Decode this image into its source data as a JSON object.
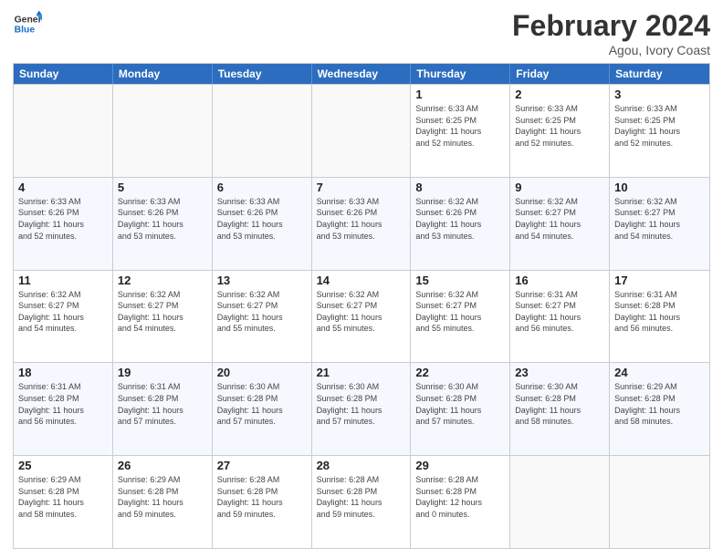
{
  "header": {
    "logo_general": "General",
    "logo_blue": "Blue",
    "month_year": "February 2024",
    "location": "Agou, Ivory Coast"
  },
  "days_of_week": [
    "Sunday",
    "Monday",
    "Tuesday",
    "Wednesday",
    "Thursday",
    "Friday",
    "Saturday"
  ],
  "rows": [
    [
      {
        "day": "",
        "info": ""
      },
      {
        "day": "",
        "info": ""
      },
      {
        "day": "",
        "info": ""
      },
      {
        "day": "",
        "info": ""
      },
      {
        "day": "1",
        "info": "Sunrise: 6:33 AM\nSunset: 6:25 PM\nDaylight: 11 hours\nand 52 minutes."
      },
      {
        "day": "2",
        "info": "Sunrise: 6:33 AM\nSunset: 6:25 PM\nDaylight: 11 hours\nand 52 minutes."
      },
      {
        "day": "3",
        "info": "Sunrise: 6:33 AM\nSunset: 6:25 PM\nDaylight: 11 hours\nand 52 minutes."
      }
    ],
    [
      {
        "day": "4",
        "info": "Sunrise: 6:33 AM\nSunset: 6:26 PM\nDaylight: 11 hours\nand 52 minutes."
      },
      {
        "day": "5",
        "info": "Sunrise: 6:33 AM\nSunset: 6:26 PM\nDaylight: 11 hours\nand 53 minutes."
      },
      {
        "day": "6",
        "info": "Sunrise: 6:33 AM\nSunset: 6:26 PM\nDaylight: 11 hours\nand 53 minutes."
      },
      {
        "day": "7",
        "info": "Sunrise: 6:33 AM\nSunset: 6:26 PM\nDaylight: 11 hours\nand 53 minutes."
      },
      {
        "day": "8",
        "info": "Sunrise: 6:32 AM\nSunset: 6:26 PM\nDaylight: 11 hours\nand 53 minutes."
      },
      {
        "day": "9",
        "info": "Sunrise: 6:32 AM\nSunset: 6:27 PM\nDaylight: 11 hours\nand 54 minutes."
      },
      {
        "day": "10",
        "info": "Sunrise: 6:32 AM\nSunset: 6:27 PM\nDaylight: 11 hours\nand 54 minutes."
      }
    ],
    [
      {
        "day": "11",
        "info": "Sunrise: 6:32 AM\nSunset: 6:27 PM\nDaylight: 11 hours\nand 54 minutes."
      },
      {
        "day": "12",
        "info": "Sunrise: 6:32 AM\nSunset: 6:27 PM\nDaylight: 11 hours\nand 54 minutes."
      },
      {
        "day": "13",
        "info": "Sunrise: 6:32 AM\nSunset: 6:27 PM\nDaylight: 11 hours\nand 55 minutes."
      },
      {
        "day": "14",
        "info": "Sunrise: 6:32 AM\nSunset: 6:27 PM\nDaylight: 11 hours\nand 55 minutes."
      },
      {
        "day": "15",
        "info": "Sunrise: 6:32 AM\nSunset: 6:27 PM\nDaylight: 11 hours\nand 55 minutes."
      },
      {
        "day": "16",
        "info": "Sunrise: 6:31 AM\nSunset: 6:27 PM\nDaylight: 11 hours\nand 56 minutes."
      },
      {
        "day": "17",
        "info": "Sunrise: 6:31 AM\nSunset: 6:28 PM\nDaylight: 11 hours\nand 56 minutes."
      }
    ],
    [
      {
        "day": "18",
        "info": "Sunrise: 6:31 AM\nSunset: 6:28 PM\nDaylight: 11 hours\nand 56 minutes."
      },
      {
        "day": "19",
        "info": "Sunrise: 6:31 AM\nSunset: 6:28 PM\nDaylight: 11 hours\nand 57 minutes."
      },
      {
        "day": "20",
        "info": "Sunrise: 6:30 AM\nSunset: 6:28 PM\nDaylight: 11 hours\nand 57 minutes."
      },
      {
        "day": "21",
        "info": "Sunrise: 6:30 AM\nSunset: 6:28 PM\nDaylight: 11 hours\nand 57 minutes."
      },
      {
        "day": "22",
        "info": "Sunrise: 6:30 AM\nSunset: 6:28 PM\nDaylight: 11 hours\nand 57 minutes."
      },
      {
        "day": "23",
        "info": "Sunrise: 6:30 AM\nSunset: 6:28 PM\nDaylight: 11 hours\nand 58 minutes."
      },
      {
        "day": "24",
        "info": "Sunrise: 6:29 AM\nSunset: 6:28 PM\nDaylight: 11 hours\nand 58 minutes."
      }
    ],
    [
      {
        "day": "25",
        "info": "Sunrise: 6:29 AM\nSunset: 6:28 PM\nDaylight: 11 hours\nand 58 minutes."
      },
      {
        "day": "26",
        "info": "Sunrise: 6:29 AM\nSunset: 6:28 PM\nDaylight: 11 hours\nand 59 minutes."
      },
      {
        "day": "27",
        "info": "Sunrise: 6:28 AM\nSunset: 6:28 PM\nDaylight: 11 hours\nand 59 minutes."
      },
      {
        "day": "28",
        "info": "Sunrise: 6:28 AM\nSunset: 6:28 PM\nDaylight: 11 hours\nand 59 minutes."
      },
      {
        "day": "29",
        "info": "Sunrise: 6:28 AM\nSunset: 6:28 PM\nDaylight: 12 hours\nand 0 minutes."
      },
      {
        "day": "",
        "info": ""
      },
      {
        "day": "",
        "info": ""
      }
    ]
  ]
}
